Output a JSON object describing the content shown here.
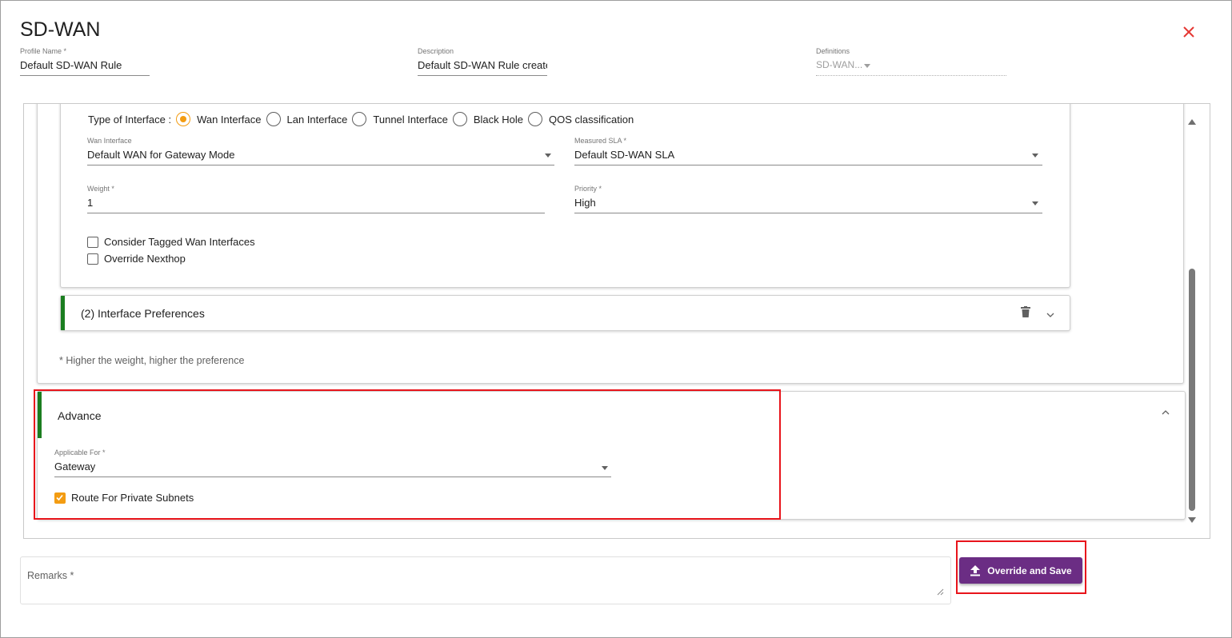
{
  "dialog": {
    "title": "SD-WAN",
    "close_icon": "close-icon",
    "close_color": "#e53935"
  },
  "header": {
    "profile_name": {
      "label": "Profile Name *",
      "value": "Default SD-WAN Rule"
    },
    "description": {
      "label": "Description",
      "value": "Default SD-WAN Rule created"
    },
    "definitions": {
      "label": "Definitions",
      "value": "SD-WAN..."
    }
  },
  "interface_pref_1": {
    "type_label": "Type of Interface :",
    "interface_types": [
      {
        "label": "Wan Interface",
        "checked": true
      },
      {
        "label": "Lan Interface",
        "checked": false
      },
      {
        "label": "Tunnel Interface",
        "checked": false
      },
      {
        "label": "Black Hole",
        "checked": false
      },
      {
        "label": "QOS classification",
        "checked": false
      }
    ],
    "wan_interface": {
      "label": "Wan Interface",
      "value": "Default WAN for Gateway Mode"
    },
    "measured_sla": {
      "label": "Measured SLA *",
      "value": "Default SD-WAN SLA"
    },
    "weight": {
      "label": "Weight *",
      "value": "1"
    },
    "priority": {
      "label": "Priority *",
      "value": "High"
    },
    "consider_tagged": {
      "label": "Consider Tagged Wan Interfaces",
      "checked": false
    },
    "override_nexthop": {
      "label": "Override Nexthop",
      "checked": false
    }
  },
  "interface_pref_2": {
    "title": "(2) Interface Preferences",
    "delete_icon": "trash-icon",
    "expand_icon": "chevron-down-icon"
  },
  "hint": "* Higher the weight, higher the preference",
  "advance": {
    "title": "Advance",
    "collapse_icon": "chevron-up-icon",
    "applicable_for": {
      "label": "Applicable For *",
      "value": "Gateway"
    },
    "route_private_subnets": {
      "label": "Route For Private Subnets",
      "checked": true
    }
  },
  "remarks": {
    "label": "Remarks *"
  },
  "save_button": {
    "label": "Override and Save",
    "icon": "upload-icon"
  },
  "colors": {
    "accent_orange": "#f39c12",
    "section_green": "#1b7e20",
    "button_purple": "#6b2d84",
    "highlight_red": "#e8141b"
  }
}
